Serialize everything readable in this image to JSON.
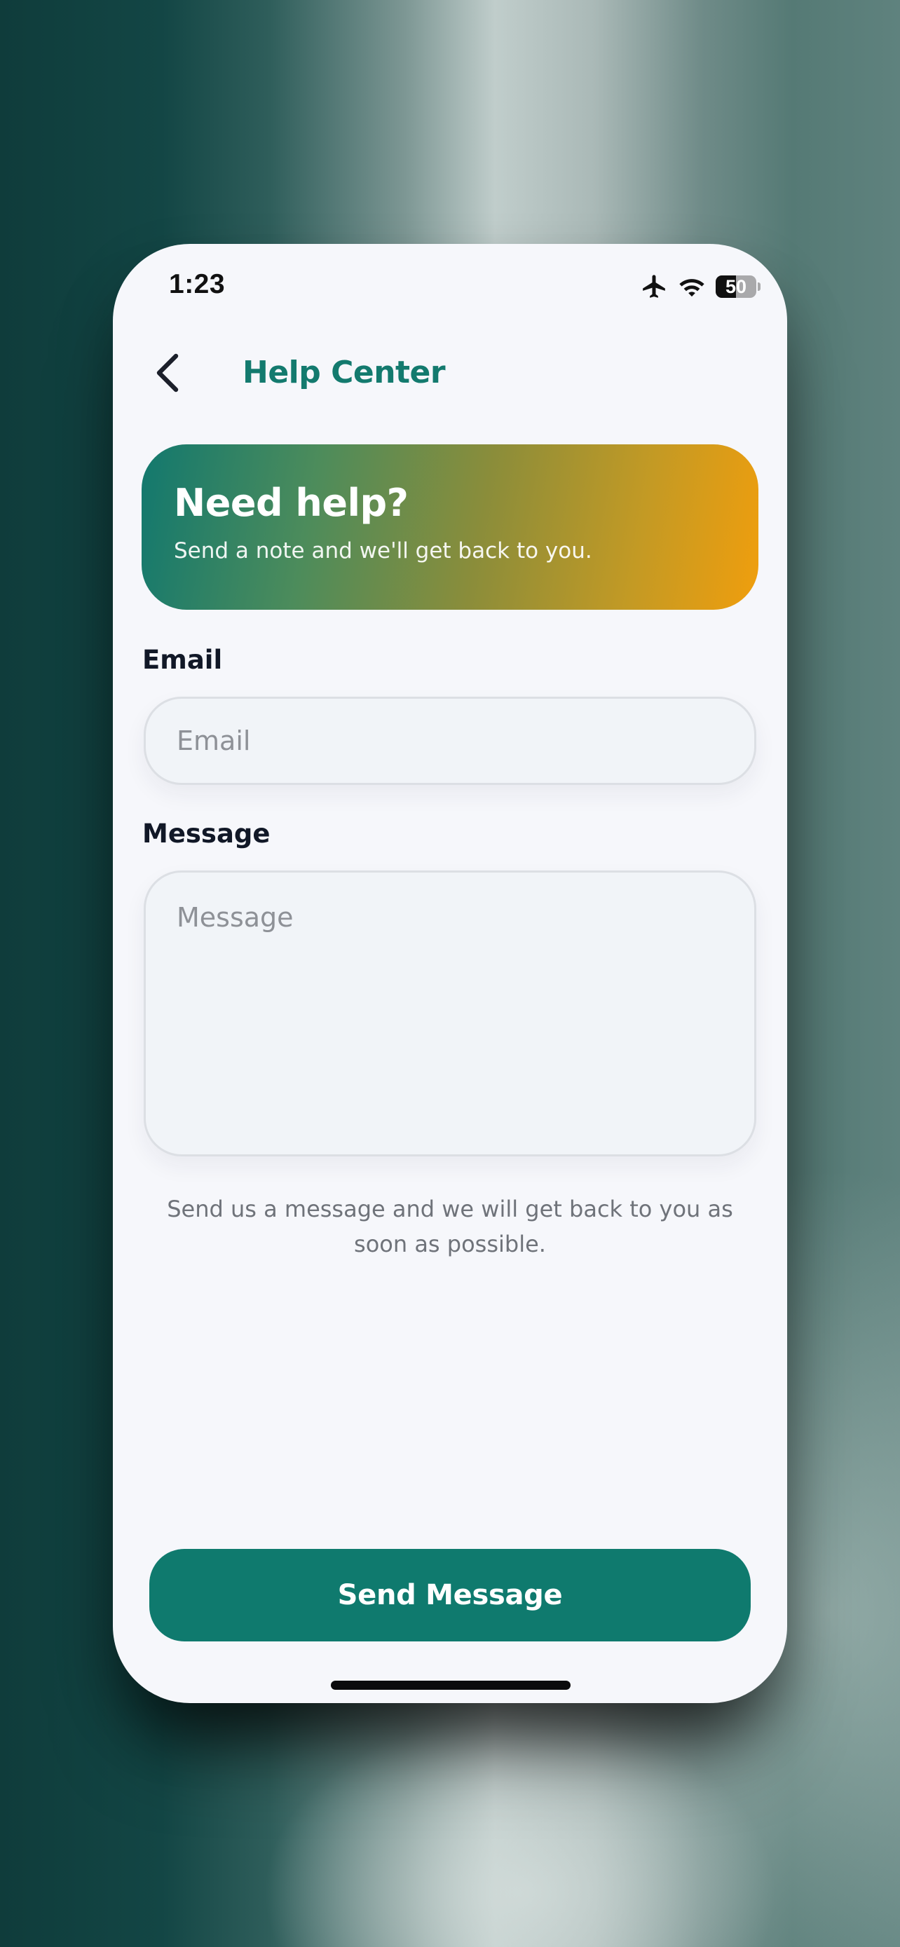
{
  "status_bar": {
    "time": "1:23",
    "battery_level": "50",
    "battery_fraction": 0.5,
    "icons": [
      "airplane-mode-icon",
      "wifi-icon",
      "battery-icon"
    ]
  },
  "header": {
    "title": "Help Center",
    "back_icon": "chevron-left-icon"
  },
  "hero": {
    "title": "Need help?",
    "subtitle": "Send a note and we'll get back to you."
  },
  "form": {
    "email_label": "Email",
    "email_value": "",
    "email_placeholder": "Email",
    "message_label": "Message",
    "message_value": "",
    "message_placeholder": "Message",
    "helper_text": "Send us a message and we will get back to you as soon as possible.",
    "submit_label": "Send Message"
  },
  "colors": {
    "brand": "#0f7a6e",
    "title": "#137a6e",
    "hero_gradient_start": "#12786e",
    "hero_gradient_end": "#f09e0d",
    "screen_background": "#f6f7fb"
  }
}
